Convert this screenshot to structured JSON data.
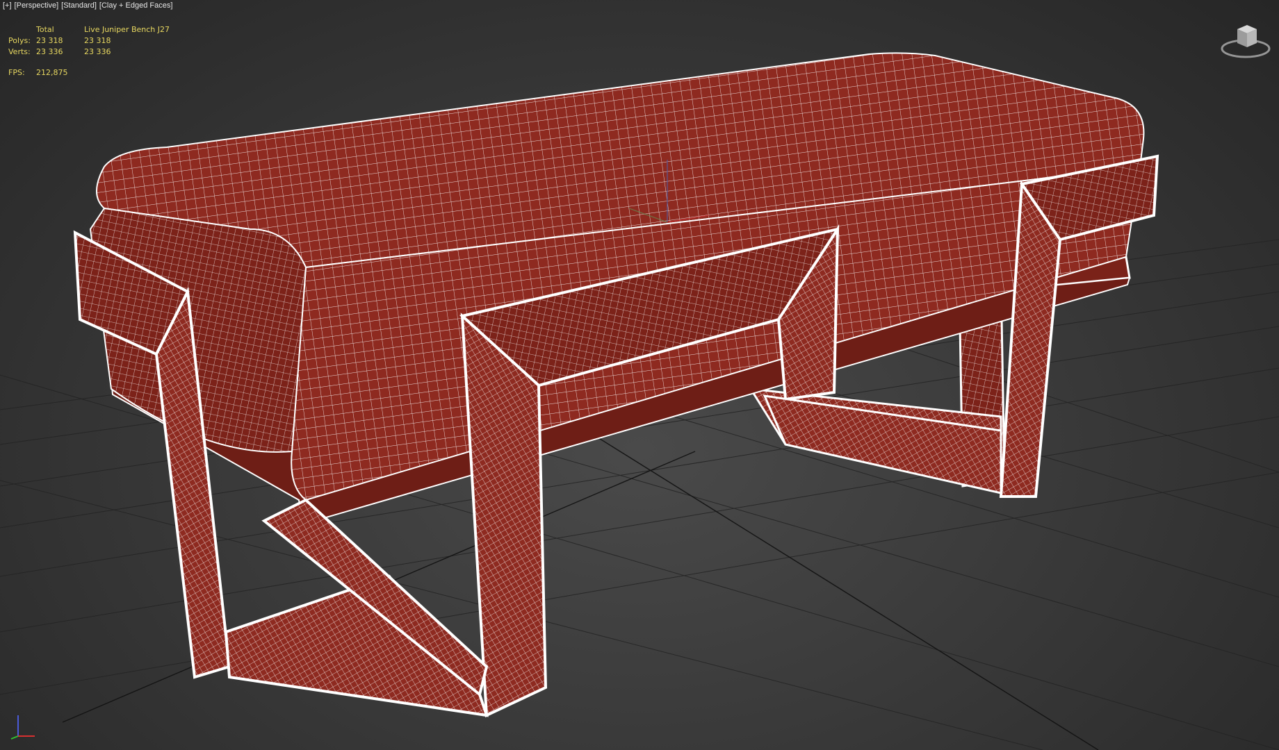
{
  "viewport": {
    "labels": [
      "[+]",
      "[Perspective]",
      "[Standard]",
      "[Clay + Edged Faces]"
    ]
  },
  "stats": {
    "header_total": "Total",
    "header_object": "Live Juniper Bench J27",
    "polys_label": "Polys:",
    "polys_total": "23 318",
    "polys_object": "23 318",
    "verts_label": "Verts:",
    "verts_total": "23 336",
    "verts_object": "23 336",
    "fps_label": "FPS:",
    "fps_value": "212,875"
  },
  "colors": {
    "clay": "#8e2a20",
    "wire": "#ffffff",
    "stats_text": "#e8d860",
    "background": "#3a3a3a"
  },
  "icons": {
    "viewcube": "viewcube-icon",
    "axis": "axis-tripod-icon"
  }
}
